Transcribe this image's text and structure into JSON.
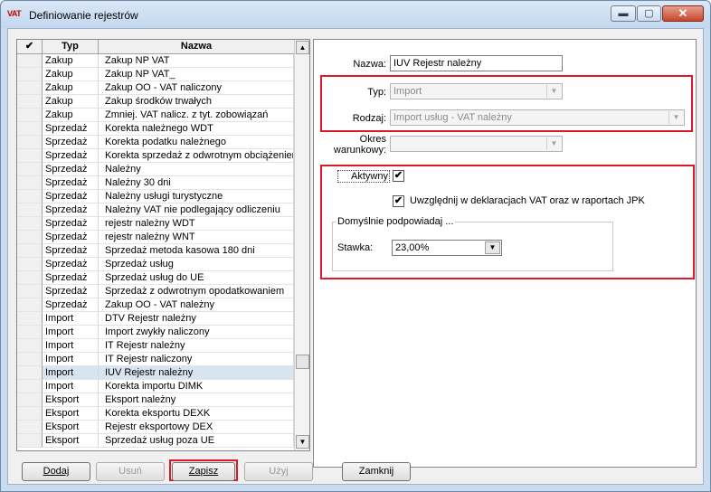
{
  "window": {
    "icon_text": "VAT",
    "title": "Definiowanie rejestrów",
    "controls": {
      "minimize": "▬",
      "maximize": "▢",
      "close": "✕"
    }
  },
  "grid": {
    "headers": {
      "check": "✔",
      "type": "Typ",
      "name": "Nazwa"
    },
    "rows": [
      {
        "type": "Zakup",
        "name": "Zakup NP VAT"
      },
      {
        "type": "Zakup",
        "name": "Zakup NP VAT_"
      },
      {
        "type": "Zakup",
        "name": "Zakup OO - VAT naliczony"
      },
      {
        "type": "Zakup",
        "name": "Zakup środków trwałych"
      },
      {
        "type": "Zakup",
        "name": "Zmniej. VAT nalicz. z tyt. zobowiązań"
      },
      {
        "type": "Sprzedaż",
        "name": "Korekta należnego WDT"
      },
      {
        "type": "Sprzedaż",
        "name": "Korekta podatku należnego"
      },
      {
        "type": "Sprzedaż",
        "name": "Korekta sprzedaż z odwrotnym obciążeniem"
      },
      {
        "type": "Sprzedaż",
        "name": "Należny"
      },
      {
        "type": "Sprzedaż",
        "name": "Należny 30 dni"
      },
      {
        "type": "Sprzedaż",
        "name": "Należny usługi turystyczne"
      },
      {
        "type": "Sprzedaż",
        "name": "Należny VAT nie podlegający odliczeniu"
      },
      {
        "type": "Sprzedaż",
        "name": "rejestr należny WDT"
      },
      {
        "type": "Sprzedaż",
        "name": "rejestr należny WNT"
      },
      {
        "type": "Sprzedaż",
        "name": "Sprzedaż metoda kasowa 180 dni"
      },
      {
        "type": "Sprzedaż",
        "name": "Sprzedaż usług"
      },
      {
        "type": "Sprzedaż",
        "name": "Sprzedaż usług do UE"
      },
      {
        "type": "Sprzedaż",
        "name": "Sprzedaż z odwrotnym opodatkowaniem"
      },
      {
        "type": "Sprzedaż",
        "name": "Zakup OO - VAT należny"
      },
      {
        "type": "Import",
        "name": "DTV Rejestr należny"
      },
      {
        "type": "Import",
        "name": "Import zwykły naliczony"
      },
      {
        "type": "Import",
        "name": "IT Rejestr należny"
      },
      {
        "type": "Import",
        "name": "IT Rejestr naliczony"
      },
      {
        "type": "Import",
        "name": "IUV Rejestr należny",
        "selected": true
      },
      {
        "type": "Import",
        "name": "Korekta importu DIMK"
      },
      {
        "type": "Eksport",
        "name": "Eksport należny"
      },
      {
        "type": "Eksport",
        "name": "Korekta eksportu DEXK"
      },
      {
        "type": "Eksport",
        "name": "Rejestr eksportowy DEX"
      },
      {
        "type": "Eksport",
        "name": "Sprzedaż usług poza UE"
      }
    ],
    "scroll_up": "▲",
    "scroll_down": "▼"
  },
  "detail": {
    "name_label": "Nazwa:",
    "name_value": "IUV Rejestr należny",
    "type_label": "Typ:",
    "type_value": "Import",
    "kind_label": "Rodzaj:",
    "kind_value": "Import usług - VAT należny",
    "period_label_1": "Okres",
    "period_label_2": "warunkowy:",
    "period_value": "",
    "active_label": "Aktywny",
    "active_checked": true,
    "include_label": "Uwzględnij w deklaracjach VAT oraz w raportach JPK",
    "include_checked": true,
    "defaults_title": "Domyślnie podpowiadaj ...",
    "rate_label": "Stawka:",
    "rate_value": "23,00%",
    "check_glyph": "✔",
    "arrow_glyph": "▼"
  },
  "buttons": {
    "add": "Dodaj",
    "remove": "Usuń",
    "save": "Zapisz",
    "use": "Użyj",
    "close": "Zamknij"
  },
  "colors": {
    "highlight": "#e0162b",
    "selection": "#d9e4f1"
  }
}
